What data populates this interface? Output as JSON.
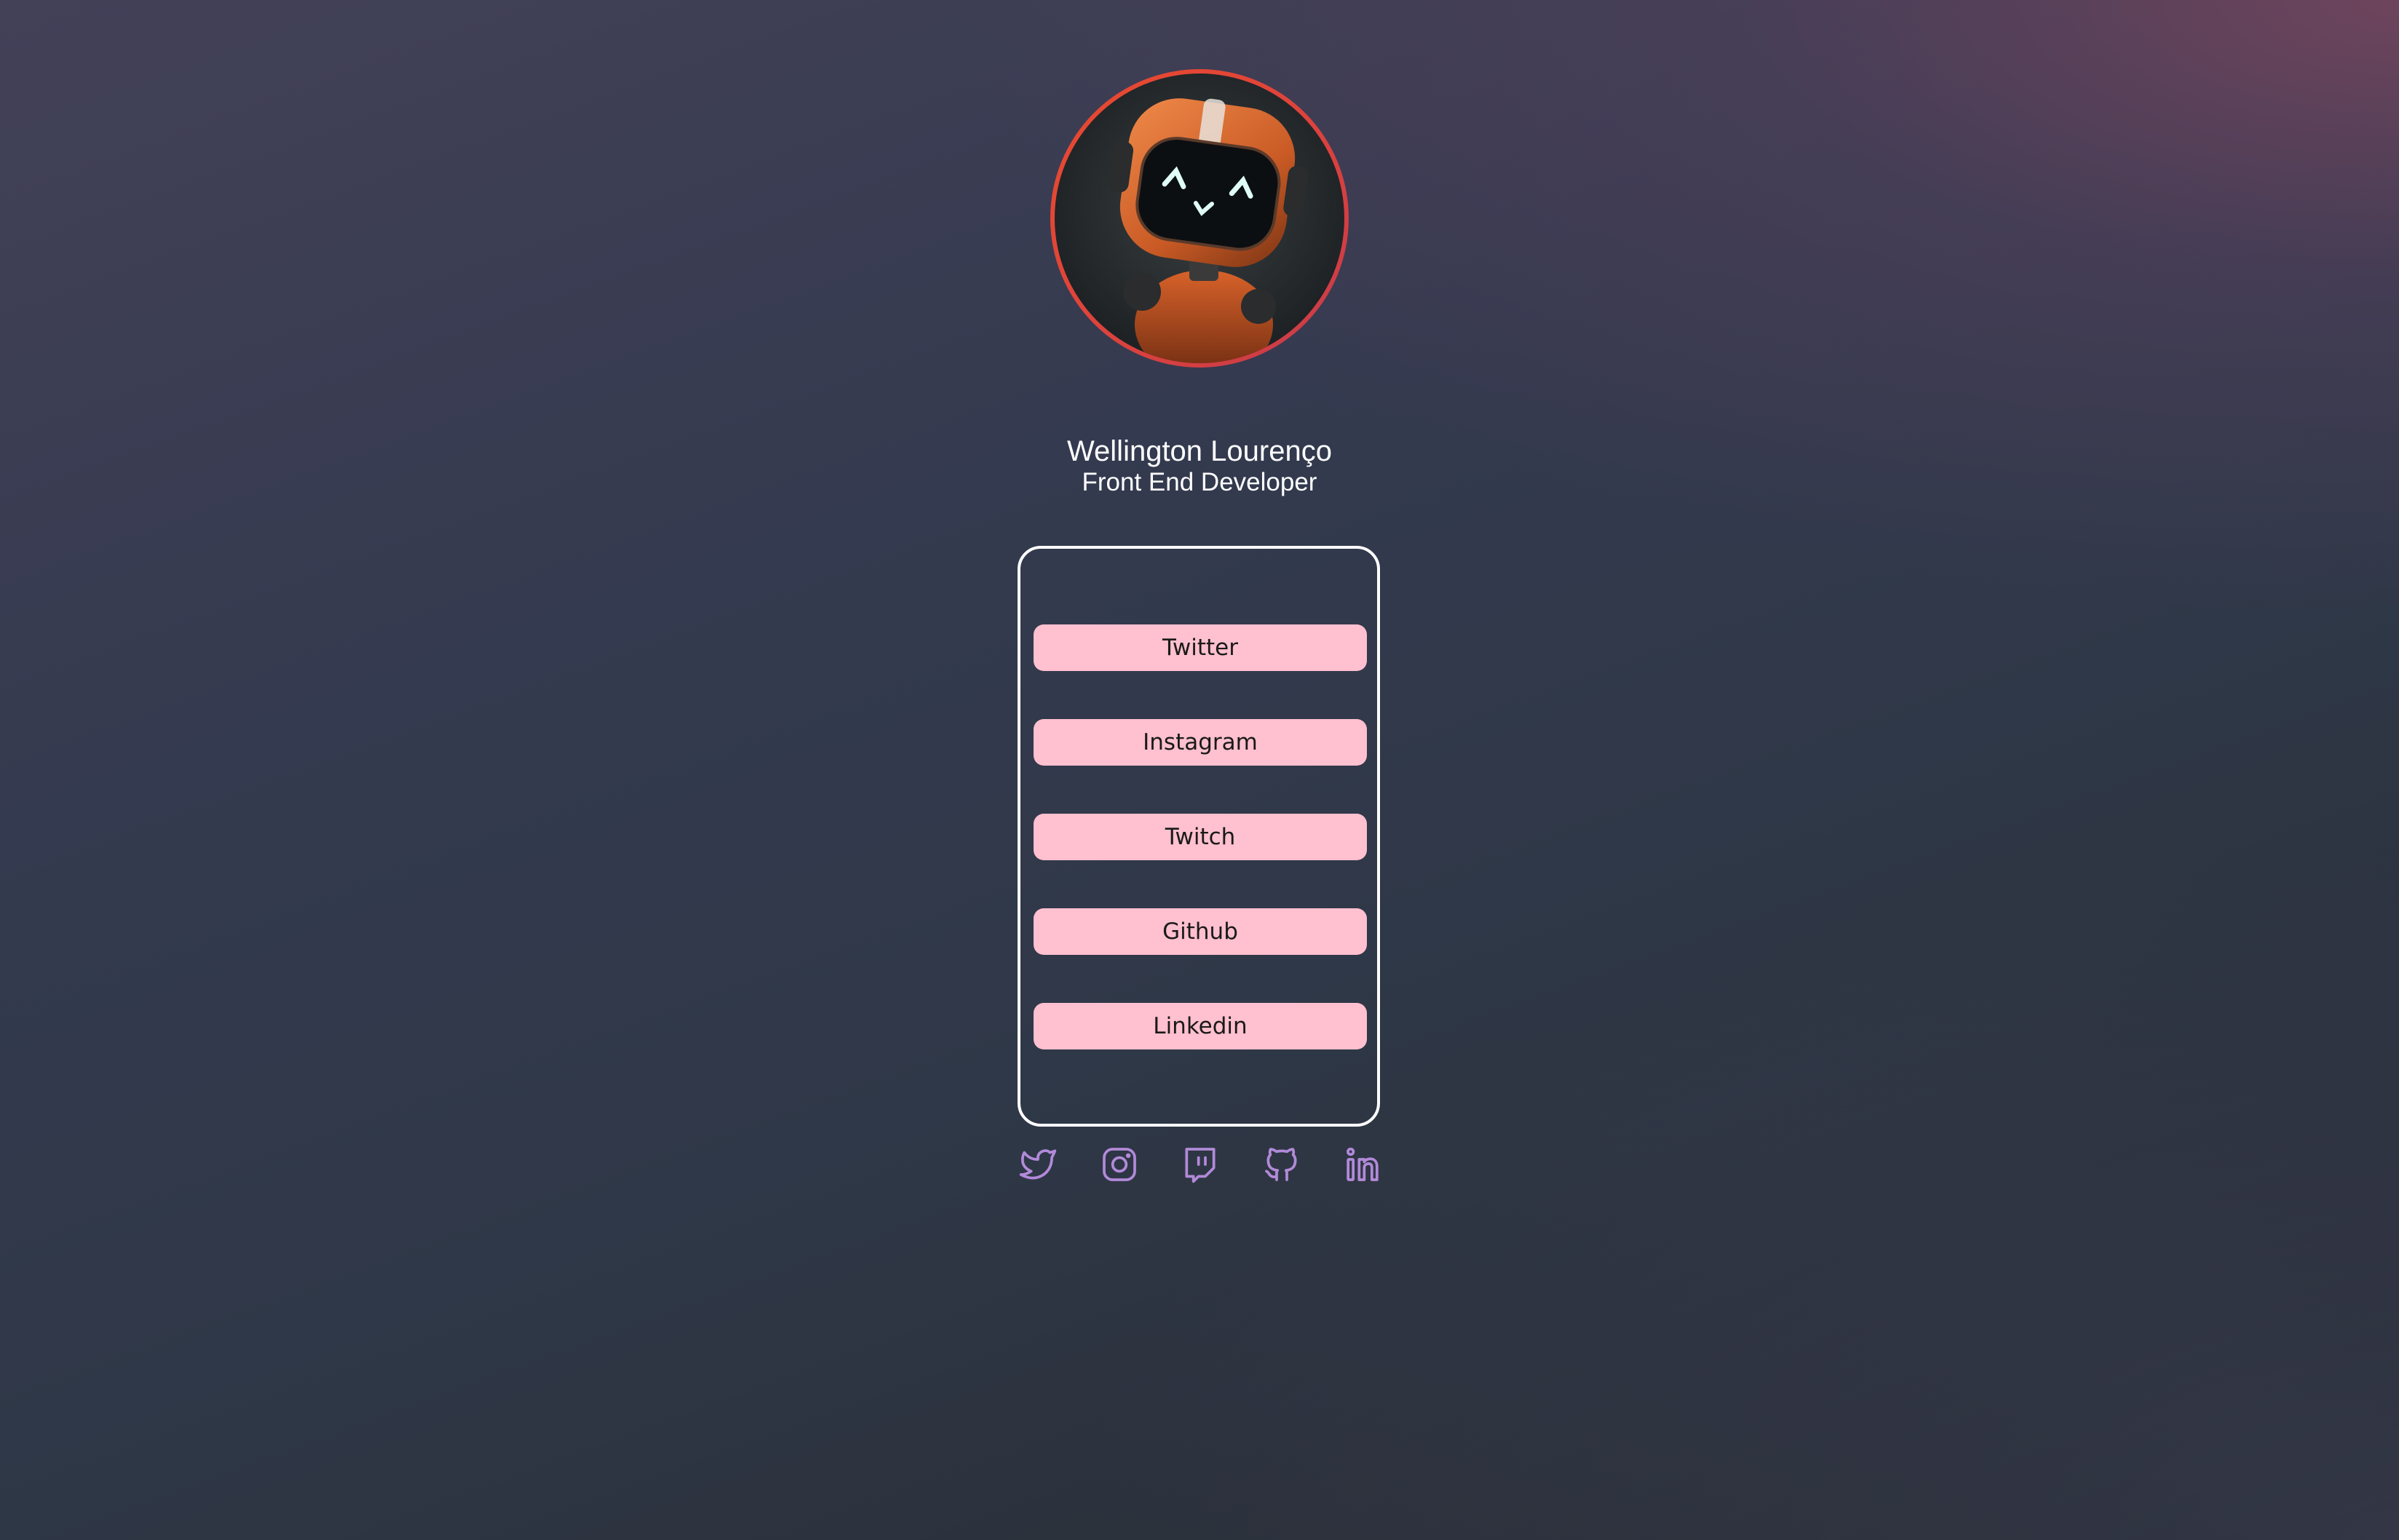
{
  "profile": {
    "name": "Wellington Lourenço",
    "role": "Front End Developer",
    "avatar_alt": "robot-avatar"
  },
  "links": [
    {
      "label": "Twitter"
    },
    {
      "label": "Instagram"
    },
    {
      "label": "Twitch"
    },
    {
      "label": "Github"
    },
    {
      "label": "Linkedin"
    }
  ],
  "social_icons": [
    "twitter-icon",
    "instagram-icon",
    "twitch-icon",
    "github-icon",
    "linkedin-icon"
  ],
  "colors": {
    "button_bg": "#ffc0cf",
    "icon_color": "#b28ad9",
    "ring_accent": "#e84a2e",
    "card_border": "#ffffff"
  }
}
